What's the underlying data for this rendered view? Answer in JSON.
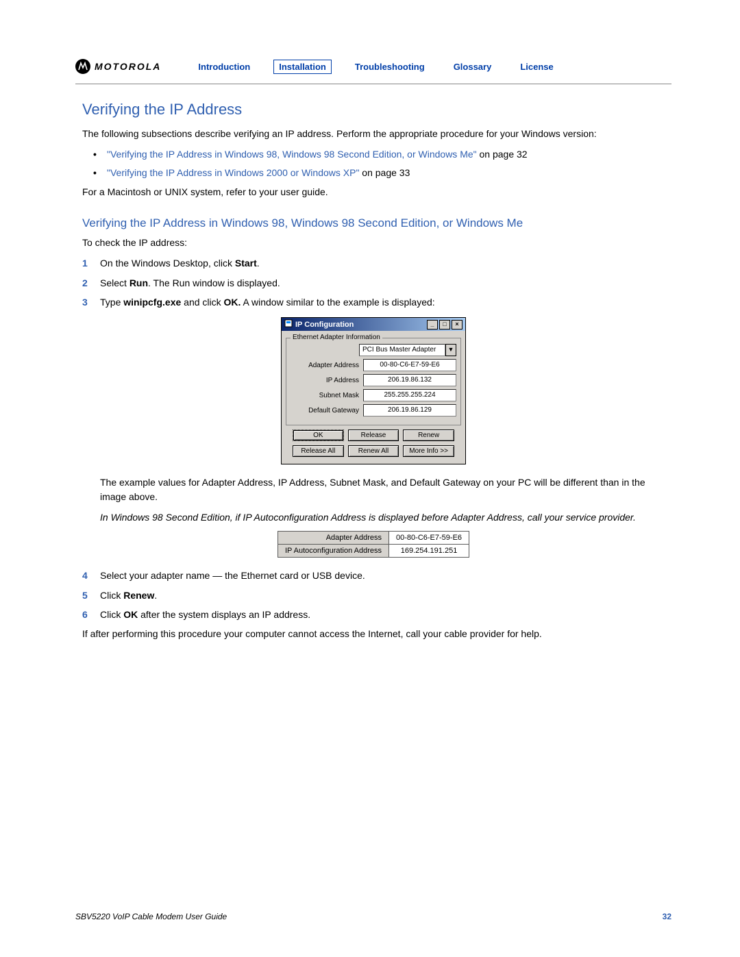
{
  "brand": "MOTOROLA",
  "nav": {
    "introduction": "Introduction",
    "installation": "Installation",
    "troubleshooting": "Troubleshooting",
    "glossary": "Glossary",
    "license": "License"
  },
  "heading": "Verifying the IP Address",
  "intro": "The following subsections describe verifying an IP address. Perform the appropriate procedure for your Windows version:",
  "bullets": {
    "b1_link": "\"Verifying the IP Address in Windows 98, Windows 98 Second Edition, or Windows Me\"",
    "b1_tail": " on page 32",
    "b2_link": "\"Verifying the IP Address in Windows 2000 or Windows XP\"",
    "b2_tail": " on page 33"
  },
  "mac_note": "For a Macintosh or UNIX system, refer to your user guide.",
  "subheading": "Verifying the IP Address in Windows 98, Windows 98 Second Edition, or Windows Me",
  "steps_intro": "To check the IP address:",
  "steps": {
    "s1a": "On the Windows Desktop, click ",
    "s1b": "Start",
    "s1c": ".",
    "s2a": "Select ",
    "s2b": "Run",
    "s2c": ". The Run window is displayed.",
    "s3a": "Type ",
    "s3b": "winipcfg.exe",
    "s3c": " and click ",
    "s3d": "OK.",
    "s3e": " A window similar to the example is displayed:",
    "s4": "Select your adapter name — the Ethernet card or USB device.",
    "s5a": "Click ",
    "s5b": "Renew",
    "s5c": ".",
    "s6a": "Click ",
    "s6b": "OK",
    "s6c": " after the system displays an IP address."
  },
  "ipcfg": {
    "title": "IP Configuration",
    "group_label": "Ethernet Adapter Information",
    "adapter_select": "PCI Bus Master Adapter",
    "labels": {
      "adapter": "Adapter Address",
      "ip": "IP Address",
      "subnet": "Subnet Mask",
      "gateway": "Default Gateway"
    },
    "values": {
      "adapter": "00-80-C6-E7-59-E6",
      "ip": "206.19.86.132",
      "subnet": "255.255.255.224",
      "gateway": "206.19.86.129"
    },
    "buttons": {
      "ok": "OK",
      "release": "Release",
      "renew": "Renew",
      "release_all": "Release All",
      "renew_all": "Renew All",
      "more": "More Info >>"
    }
  },
  "after_img": "The example values for Adapter Address, IP Address, Subnet Mask, and Default Gateway on your PC will be different than in the image above.",
  "italic_note": "In Windows 98 Second Edition, if IP Autoconfiguration Address is displayed before Adapter Address, call your service provider.",
  "autotable": {
    "r1l": "Adapter Address",
    "r1v": "00-80-C6-E7-59-E6",
    "r2l": "IP Autoconfiguration Address",
    "r2v": "169.254.191.251"
  },
  "closing": "If after performing this procedure your computer cannot access the Internet, call your cable provider for help.",
  "footer": {
    "title": "SBV5220 VoIP Cable Modem User Guide",
    "page": "32"
  }
}
